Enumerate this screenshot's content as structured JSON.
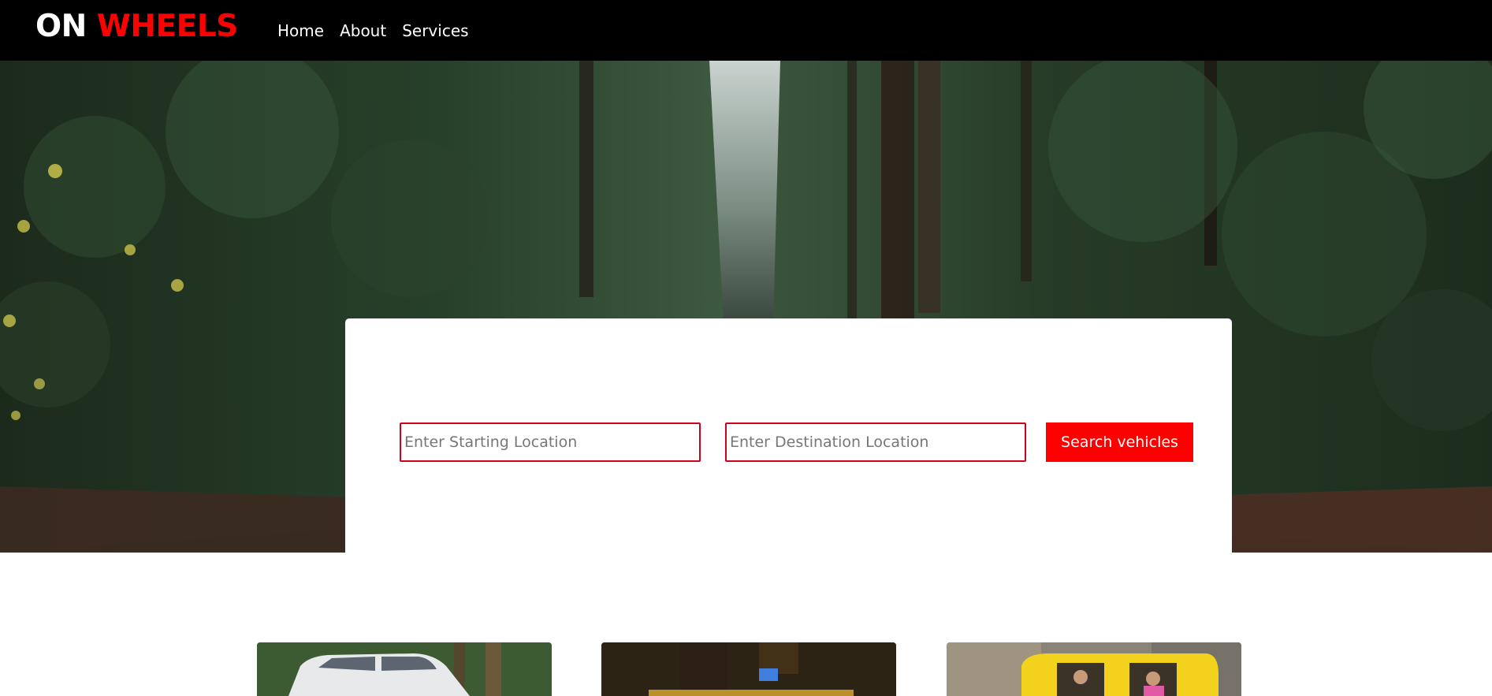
{
  "brand": {
    "on": "ON",
    "wheels": "WHEELS"
  },
  "nav": {
    "items": [
      {
        "label": "Home"
      },
      {
        "label": "About"
      },
      {
        "label": "Services"
      }
    ]
  },
  "search": {
    "start_placeholder": "Enter Starting Location",
    "destination_placeholder": "Enter Destination Location",
    "button_label": "Search vehicles"
  },
  "colors": {
    "accent": "#ff0000",
    "navbar": "#000000"
  },
  "vehicles": [
    {
      "icon": "white-car-photo"
    },
    {
      "icon": "yellow-taxi-photo"
    },
    {
      "icon": "auto-rickshaw-photo"
    }
  ]
}
